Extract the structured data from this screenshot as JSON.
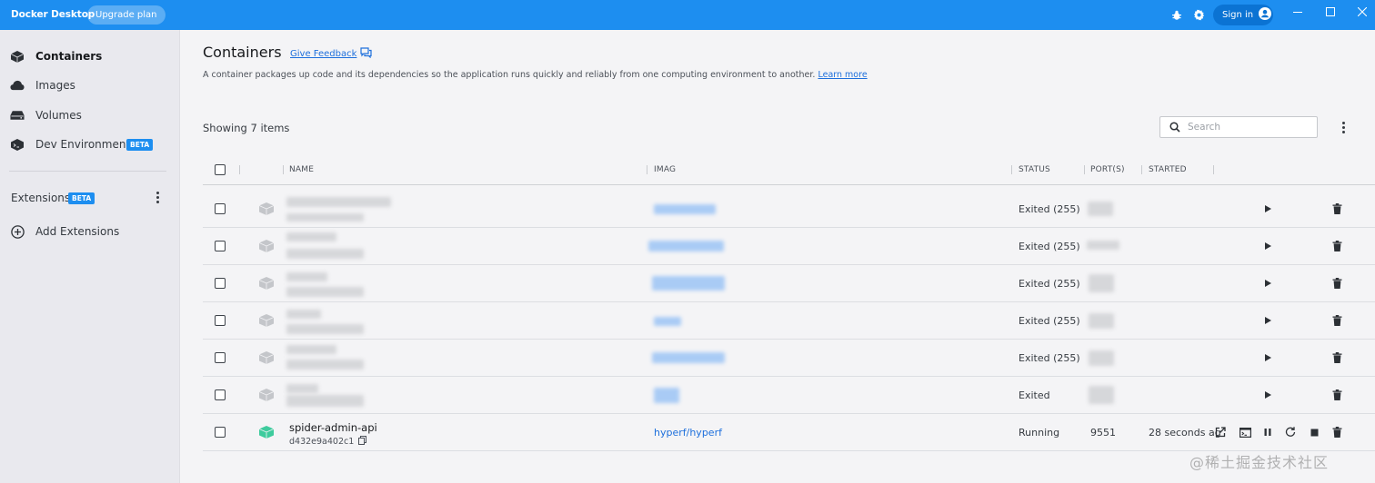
{
  "titlebar": {
    "app_title": "Docker Desktop",
    "upgrade_label": "Upgrade plan",
    "signin_label": "Sign in",
    "icons": [
      "bug-icon",
      "gear-icon",
      "user-icon",
      "minimize-icon",
      "maximize-icon",
      "close-icon"
    ],
    "background": "#1d8ef0"
  },
  "sidebar": {
    "items": [
      {
        "label": "Containers",
        "icon": "container-icon",
        "active": true
      },
      {
        "label": "Images",
        "icon": "cloud-icon"
      },
      {
        "label": "Volumes",
        "icon": "volume-icon"
      },
      {
        "label": "Dev Environments",
        "icon": "dev-env-icon",
        "badge": "BETA"
      }
    ],
    "extensions_label": "Extensions",
    "extensions_badge": "BETA",
    "add_extensions_label": "Add Extensions"
  },
  "main": {
    "title": "Containers",
    "feedback_label": "Give Feedback",
    "description": "A container packages up code and its dependencies so the application runs quickly and reliably from one computing environment to another.",
    "learn_more": "Learn more",
    "showing": "Showing 7 items",
    "search_placeholder": "Search"
  },
  "table": {
    "columns": [
      "NAME",
      "IMAG",
      "STATUS",
      "PORT(S)",
      "STARTED"
    ],
    "rows": [
      {
        "status": "Exited (255)"
      },
      {
        "status": "Exited (255)"
      },
      {
        "status": "Exited (255)"
      },
      {
        "status": "Exited (255)"
      },
      {
        "status": "Exited (255)"
      },
      {
        "status": "Exited"
      },
      {
        "name": "spider-admin-api",
        "id": "d432e9a402c1",
        "image": "hyperf/hyperf",
        "status": "Running",
        "port": "9551",
        "started": "28 seconds ago"
      }
    ]
  },
  "watermark": "@稀土掘金技术社区",
  "colors": {
    "accent": "#1d8ef0",
    "link": "#1d6fdc",
    "running": "#3ecb9d"
  }
}
